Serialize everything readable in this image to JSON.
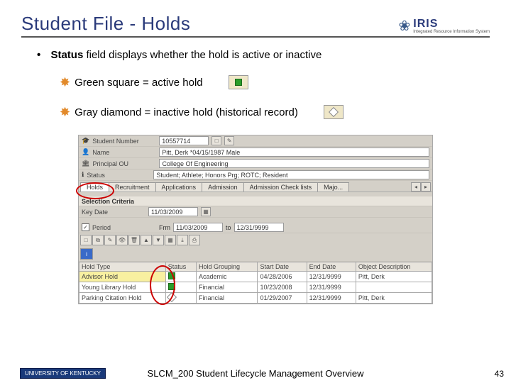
{
  "slide": {
    "title": "Student File - Holds",
    "bullet_prefix": "Status",
    "bullet_rest": " field displays whether the hold is active or inactive",
    "legend_active": "Green square = active hold",
    "legend_inactive": "Gray diamond = inactive hold (historical record)"
  },
  "logo": {
    "iris": "IRIS",
    "iris_sub": "Integrated Resource Information System",
    "uk": "UNIVERSITY OF KENTUCKY"
  },
  "sap": {
    "labels": {
      "student_number": "Student Number",
      "name": "Name",
      "principal_ou": "Principal OU",
      "status": "Status",
      "selection_criteria": "Selection Criteria",
      "key_date": "Key Date",
      "period": "Period",
      "frm": "Frm",
      "to": "to"
    },
    "fields": {
      "student_number_val": "10557714",
      "name_val": "Pitt, Derk *04/15/1987 Male",
      "ou_val": "College Of Engineering",
      "status_val": "Student; Athlete; Honors Prg; ROTC; Resident",
      "key_date_val": "11/03/2009",
      "frm_val": "11/03/2009",
      "to_val": "12/31/9999",
      "period_checked": "✓"
    },
    "tabs": {
      "holds": "Holds",
      "recruitment": "Recruitment",
      "applications": "Applications",
      "admission": "Admission",
      "admission_check": "Admission Check lists",
      "majo": "Majo..."
    },
    "grid": {
      "headers": {
        "hold_type": "Hold Type",
        "status": "Status",
        "hold_grouping": "Hold Grouping",
        "start_date": "Start Date",
        "end_date": "End Date",
        "object_desc": "Object Description"
      },
      "rows": [
        {
          "type": "Advisor Hold",
          "status_shape": "green",
          "group": "Academic",
          "start": "04/28/2006",
          "end": "12/31/9999",
          "obj": "Pitt, Derk"
        },
        {
          "type": "Young Library Hold",
          "status_shape": "green",
          "group": "Financial",
          "start": "10/23/2008",
          "end": "12/31/9999",
          "obj": ""
        },
        {
          "type": "Parking Citation Hold",
          "status_shape": "diamond",
          "group": "Financial",
          "start": "01/29/2007",
          "end": "12/31/9999",
          "obj": "Pitt, Derk"
        }
      ]
    }
  },
  "footer": {
    "text": "SLCM_200 Student Lifecycle Management Overview",
    "page": "43"
  }
}
